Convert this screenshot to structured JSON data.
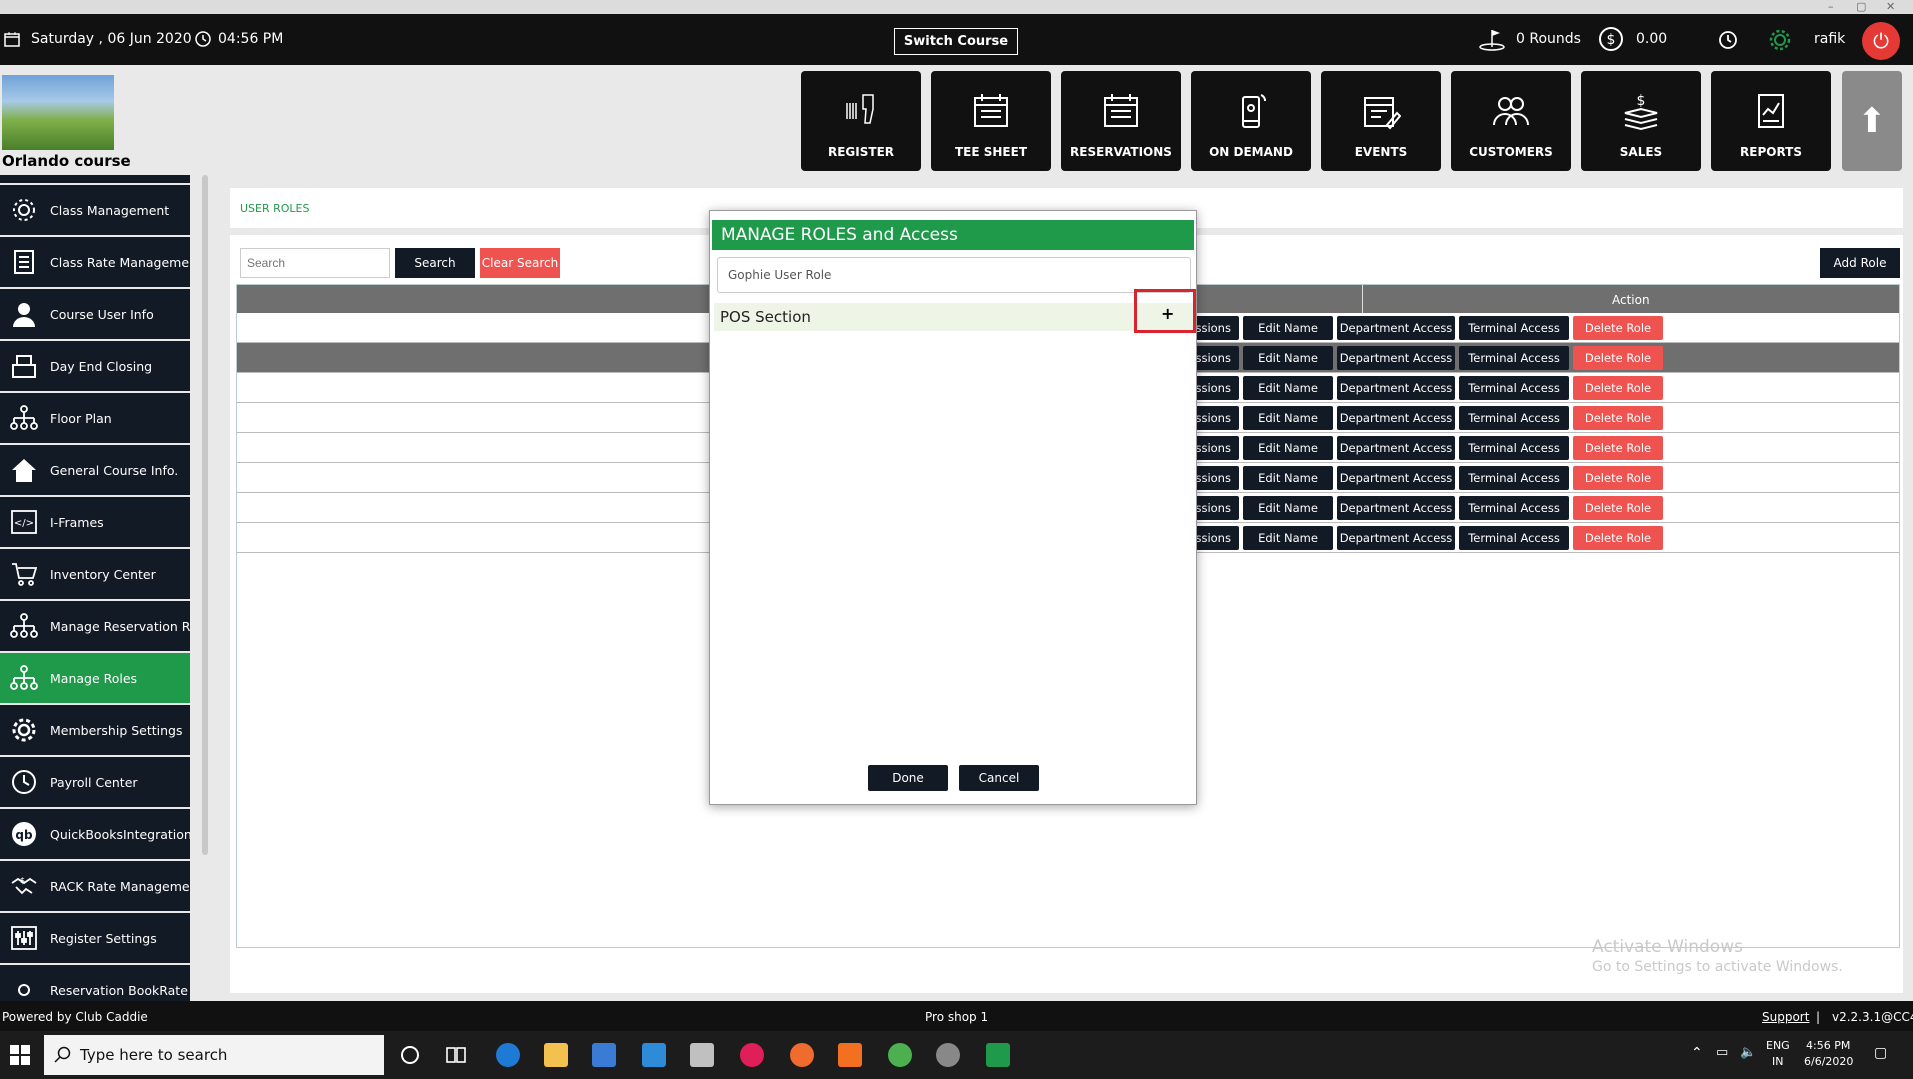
{
  "window": {
    "controls": [
      "–",
      "▢",
      "✕"
    ]
  },
  "topbar": {
    "date": "Saturday ,  06 Jun 2020",
    "time": "04:56 PM",
    "switch_course": "Switch Course",
    "rounds": "0 Rounds",
    "balance": "0.00",
    "username": "rafik",
    "icons": [
      "calendar-icon",
      "clock-icon",
      "golfer-icon",
      "dollar-icon",
      "history-icon",
      "gear-icon",
      "power-icon"
    ]
  },
  "brand": {
    "course_name": "Orlando course"
  },
  "nav": [
    {
      "label": "REGISTER",
      "icon": "barcode-scanner-icon"
    },
    {
      "label": "TEE SHEET",
      "icon": "calendar-icon"
    },
    {
      "label": "RESERVATIONS",
      "icon": "calendar-icon"
    },
    {
      "label": "ON DEMAND",
      "icon": "phone-icon"
    },
    {
      "label": "EVENTS",
      "icon": "calendar-edit-icon"
    },
    {
      "label": "CUSTOMERS",
      "icon": "users-icon"
    },
    {
      "label": "SALES",
      "icon": "money-icon"
    },
    {
      "label": "REPORTS",
      "icon": "report-icon"
    }
  ],
  "sidebar": {
    "items": [
      {
        "label": "Class Management",
        "icon": "gear-icon"
      },
      {
        "label": "Class Rate Management",
        "icon": "list-icon"
      },
      {
        "label": "Course User Info",
        "icon": "user-icon"
      },
      {
        "label": "Day End Closing",
        "icon": "register-icon"
      },
      {
        "label": "Floor Plan",
        "icon": "org-chart-icon"
      },
      {
        "label": "General Course Info.",
        "icon": "home-icon"
      },
      {
        "label": "I-Frames",
        "icon": "code-icon"
      },
      {
        "label": "Inventory Center",
        "icon": "cart-icon"
      },
      {
        "label": "Manage Reservation R...",
        "icon": "org-chart-icon"
      },
      {
        "label": "Manage Roles",
        "icon": "org-chart-icon",
        "active": true
      },
      {
        "label": "Membership Settings",
        "icon": "gear-icon"
      },
      {
        "label": "Payroll Center",
        "icon": "clock-icon"
      },
      {
        "label": "QuickBooksIntegration",
        "icon": "quickbooks-icon"
      },
      {
        "label": "RACK Rate Manageme...",
        "icon": "handshake-icon"
      },
      {
        "label": "Register Settings",
        "icon": "sliders-icon"
      },
      {
        "label": "Reservation BookRate",
        "icon": "gear-icon"
      }
    ]
  },
  "page": {
    "title": "USER ROLES",
    "search_placeholder": "Search",
    "search_button": "Search",
    "clear_button": "Clear Search",
    "add_role_button": "Add Role",
    "action_header": "Action",
    "row_actions": [
      "Edit Permissions",
      "Edit Name",
      "Department Access",
      "Terminal Access",
      "Delete Role"
    ],
    "row_count": 8
  },
  "modal": {
    "title": "MANAGE ROLES and Access",
    "role_name": "Gophie User Role",
    "section_label": "POS Section",
    "expand_symbol": "+",
    "done": "Done",
    "cancel": "Cancel"
  },
  "watermark": {
    "line1": "Activate Windows",
    "line2": "Go to Settings to activate Windows."
  },
  "footer": {
    "powered_by": "Powered by Club Caddie",
    "terminal": "Pro shop 1",
    "support": "Support",
    "separator": "|",
    "version": "v2.2.3.1@CC4"
  },
  "taskbar": {
    "search_placeholder": "Type here to search",
    "lang_top": "ENG",
    "lang_bottom": "IN",
    "clock_time": "4:56 PM",
    "clock_date": "6/6/2020",
    "apps": [
      "cortana-icon",
      "taskview-icon",
      "edge-icon",
      "explorer-icon",
      "store-icon",
      "mail-icon",
      "tool-icon",
      "slack-icon",
      "postman-icon",
      "app-icon",
      "chrome-icon",
      "app-icon",
      "app-icon"
    ]
  },
  "colors": {
    "accent_green": "#1f9a4a",
    "dark": "#121a26",
    "danger": "#ef5350",
    "highlight": "#d9232e"
  }
}
